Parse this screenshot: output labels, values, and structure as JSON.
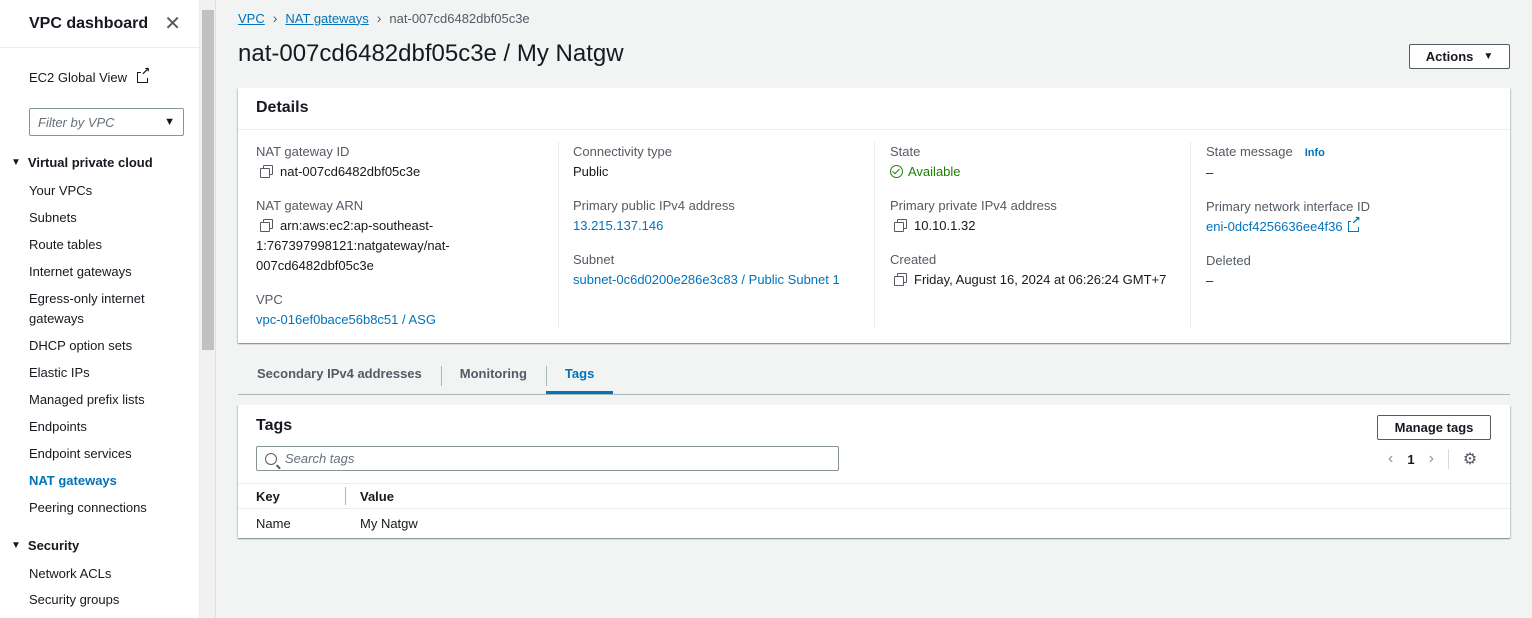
{
  "sidebar": {
    "title": "VPC dashboard",
    "global_view": "EC2 Global View",
    "filter_placeholder": "Filter by VPC",
    "section_vpc": "Virtual private cloud",
    "items": [
      {
        "label": "Your VPCs"
      },
      {
        "label": "Subnets"
      },
      {
        "label": "Route tables"
      },
      {
        "label": "Internet gateways"
      },
      {
        "label": "Egress-only internet gateways"
      },
      {
        "label": "DHCP option sets"
      },
      {
        "label": "Elastic IPs"
      },
      {
        "label": "Managed prefix lists"
      },
      {
        "label": "Endpoints"
      },
      {
        "label": "Endpoint services"
      },
      {
        "label": "NAT gateways"
      },
      {
        "label": "Peering connections"
      }
    ],
    "section_security": "Security",
    "security_items": [
      {
        "label": "Network ACLs"
      },
      {
        "label": "Security groups"
      }
    ]
  },
  "breadcrumb": {
    "vpc": "VPC",
    "nat_gateways": "NAT gateways",
    "current": "nat-007cd6482dbf05c3e"
  },
  "page_title": "nat-007cd6482dbf05c3e / My Natgw",
  "actions_label": "Actions",
  "details": {
    "header": "Details",
    "nat_id_label": "NAT gateway ID",
    "nat_id_value": "nat-007cd6482dbf05c3e",
    "nat_arn_label": "NAT gateway ARN",
    "nat_arn_value_1": "arn:aws:ec2:ap-southeast-",
    "nat_arn_value_2": "1:767397998121:natgateway/nat-",
    "nat_arn_value_3": "007cd6482dbf05c3e",
    "vpc_label": "VPC",
    "vpc_value": "vpc-016ef0bace56b8c51 / ASG",
    "connectivity_label": "Connectivity type",
    "connectivity_value": "Public",
    "public_ip_label": "Primary public IPv4 address",
    "public_ip_value": "13.215.137.146",
    "subnet_label": "Subnet",
    "subnet_value": "subnet-0c6d0200e286e3c83 / Public Subnet 1",
    "state_label": "State",
    "state_value": "Available",
    "private_ip_label": "Primary private IPv4 address",
    "private_ip_value": "10.10.1.32",
    "created_label": "Created",
    "created_value": "Friday, August 16, 2024 at 06:26:24 GMT+7",
    "state_message_label": "State message",
    "info_label": "Info",
    "state_message_value": "–",
    "eni_label": "Primary network interface ID",
    "eni_value": "eni-0dcf4256636ee4f36",
    "deleted_label": "Deleted",
    "deleted_value": "–"
  },
  "tabs": [
    {
      "label": "Secondary IPv4 addresses"
    },
    {
      "label": "Monitoring"
    },
    {
      "label": "Tags"
    }
  ],
  "tags_panel": {
    "title": "Tags",
    "manage_label": "Manage tags",
    "search_placeholder": "Search tags",
    "page": "1",
    "col_key": "Key",
    "col_value": "Value",
    "rows": [
      {
        "key": "Name",
        "value": "My Natgw"
      }
    ]
  },
  "colors": {
    "link": "#0073bb",
    "success": "#1d8102",
    "text": "#16191f",
    "muted": "#545b64"
  }
}
